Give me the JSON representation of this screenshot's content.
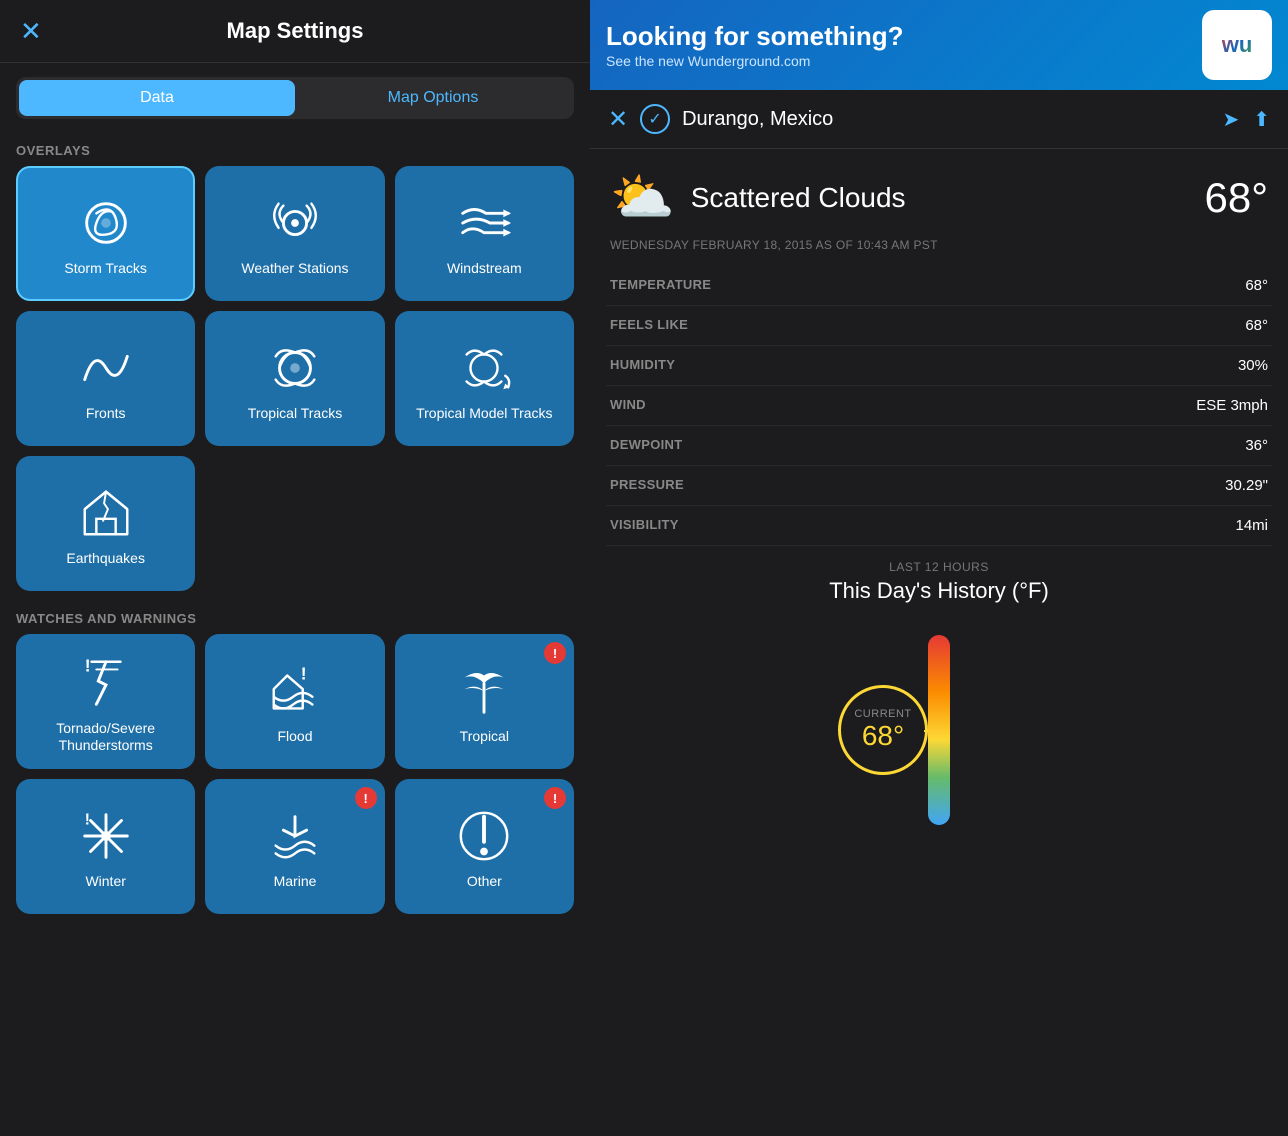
{
  "left": {
    "title": "Map Settings",
    "close_label": "✕",
    "tabs": [
      {
        "id": "data",
        "label": "Data",
        "active": true
      },
      {
        "id": "map-options",
        "label": "Map Options",
        "active": false
      }
    ],
    "overlays_label": "OVERLAYS",
    "overlays": [
      {
        "id": "storm-tracks",
        "label": "Storm Tracks",
        "selected": true
      },
      {
        "id": "weather-stations",
        "label": "Weather Stations",
        "selected": false
      },
      {
        "id": "windstream",
        "label": "Windstream",
        "selected": false
      },
      {
        "id": "fronts",
        "label": "Fronts",
        "selected": false
      },
      {
        "id": "tropical-tracks",
        "label": "Tropical Tracks",
        "selected": false
      },
      {
        "id": "tropical-model-tracks",
        "label": "Tropical Model Tracks",
        "selected": false
      },
      {
        "id": "earthquakes",
        "label": "Earthquakes",
        "selected": false
      }
    ],
    "watches_label": "WATCHES AND WARNINGS",
    "watches": [
      {
        "id": "tornado",
        "label": "Tornado/Severe Thunderstorms",
        "badge": null
      },
      {
        "id": "flood",
        "label": "Flood",
        "badge": null
      },
      {
        "id": "tropical",
        "label": "Tropical",
        "badge": "!"
      },
      {
        "id": "winter",
        "label": "Winter",
        "badge": null
      },
      {
        "id": "marine",
        "label": "Marine",
        "badge": "!"
      },
      {
        "id": "other",
        "label": "Other",
        "badge": "!"
      }
    ]
  },
  "right": {
    "ad": {
      "title": "Looking for something?",
      "subtitle": "See the new Wunderground.com",
      "logo_text": "wu"
    },
    "location": {
      "name": "Durango, Mexico"
    },
    "weather": {
      "condition": "Scattered Clouds",
      "temperature": "68°",
      "date": "WEDNESDAY FEBRUARY 18, 2015 AS OF 10:43 AM PST"
    },
    "stats": [
      {
        "label": "TEMPERATURE",
        "value": "68°"
      },
      {
        "label": "FEELS LIKE",
        "value": "68°"
      },
      {
        "label": "HUMIDITY",
        "value": "30%"
      },
      {
        "label": "WIND",
        "value": "ESE 3mph"
      },
      {
        "label": "DEWPOINT",
        "value": "36°"
      },
      {
        "label": "PRESSURE",
        "value": "30.29\""
      },
      {
        "label": "VISIBILITY",
        "value": "14mi"
      }
    ],
    "history": {
      "sublabel": "LAST 12 HOURS",
      "title": "This Day's History (°F)",
      "current_label": "CURRENT",
      "current_temp": "68°"
    }
  }
}
